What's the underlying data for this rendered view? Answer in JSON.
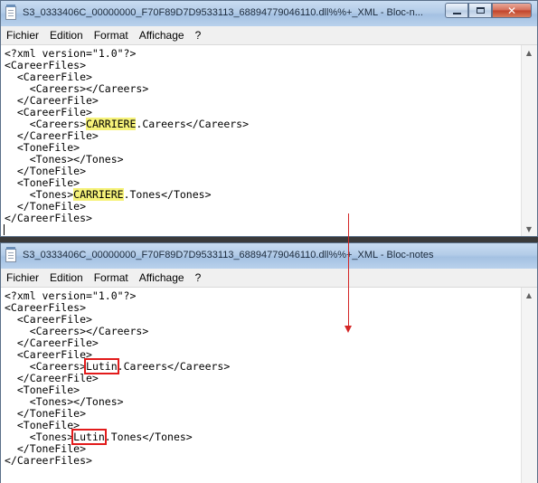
{
  "window_top": {
    "title": "S3_0333406C_00000000_F70F89D7D9533113_68894779046110.dll%%+_XML - Bloc-n...",
    "menu": [
      "Fichier",
      "Edition",
      "Format",
      "Affichage",
      "?"
    ],
    "lines": [
      [
        {
          "t": "<?xml version=\"1.0\"?>"
        }
      ],
      [
        {
          "t": "<CareerFiles>"
        }
      ],
      [
        {
          "t": "  <CareerFile>"
        }
      ],
      [
        {
          "t": "    <Careers></Careers>"
        }
      ],
      [
        {
          "t": "  </CareerFile>"
        }
      ],
      [
        {
          "t": "  <CareerFile>"
        }
      ],
      [
        {
          "t": "    <Careers>"
        },
        {
          "t": "CARRIERE",
          "hl": true
        },
        {
          "t": ".Careers</Careers>"
        }
      ],
      [
        {
          "t": "  </CareerFile>"
        }
      ],
      [
        {
          "t": "  <ToneFile>"
        }
      ],
      [
        {
          "t": "    <Tones></Tones>"
        }
      ],
      [
        {
          "t": "  </ToneFile>"
        }
      ],
      [
        {
          "t": "  <ToneFile>"
        }
      ],
      [
        {
          "t": "    <Tones>"
        },
        {
          "t": "CARRIERE",
          "hl": true
        },
        {
          "t": ".Tones</Tones>"
        }
      ],
      [
        {
          "t": "  </ToneFile>"
        }
      ],
      [
        {
          "t": "</CareerFiles>"
        }
      ]
    ]
  },
  "window_bottom": {
    "title": "S3_0333406C_00000000_F70F89D7D9533113_68894779046110.dll%%+_XML - Bloc-notes",
    "menu": [
      "Fichier",
      "Edition",
      "Format",
      "Affichage",
      "?"
    ],
    "lines": [
      [
        {
          "t": "<?xml version=\"1.0\"?>"
        }
      ],
      [
        {
          "t": "<CareerFiles>"
        }
      ],
      [
        {
          "t": "  <CareerFile>"
        }
      ],
      [
        {
          "t": "    <Careers></Careers>"
        }
      ],
      [
        {
          "t": "  </CareerFile>"
        }
      ],
      [
        {
          "t": "  <CareerFile>"
        }
      ],
      [
        {
          "t": "    <Careers>"
        },
        {
          "t": "Lutin",
          "box": true
        },
        {
          "t": ".Careers</Careers>"
        }
      ],
      [
        {
          "t": "  </CareerFile>"
        }
      ],
      [
        {
          "t": "  <ToneFile>"
        }
      ],
      [
        {
          "t": "    <Tones></Tones>"
        }
      ],
      [
        {
          "t": "  </ToneFile>"
        }
      ],
      [
        {
          "t": "  <ToneFile>"
        }
      ],
      [
        {
          "t": "    <Tones>"
        },
        {
          "t": "Lutin",
          "box": true
        },
        {
          "t": ".Tones</Tones>"
        }
      ],
      [
        {
          "t": "  </ToneFile>"
        }
      ],
      [
        {
          "t": "</CareerFiles>"
        }
      ]
    ]
  },
  "icons": {
    "app": "notepad-icon",
    "minimize": "minimize-icon",
    "maximize": "maximize-icon",
    "close": "close-icon",
    "scroll_up": "scroll-up-icon",
    "scroll_down": "scroll-down-icon",
    "annotation_arrow": "arrow-down-icon"
  },
  "colors": {
    "highlight": "#f6f279",
    "annotation": "#e21b1b",
    "arrow": "#d42626"
  },
  "glyphs": {
    "close": "✕",
    "scroll_up": "▲",
    "scroll_down": "▼"
  }
}
